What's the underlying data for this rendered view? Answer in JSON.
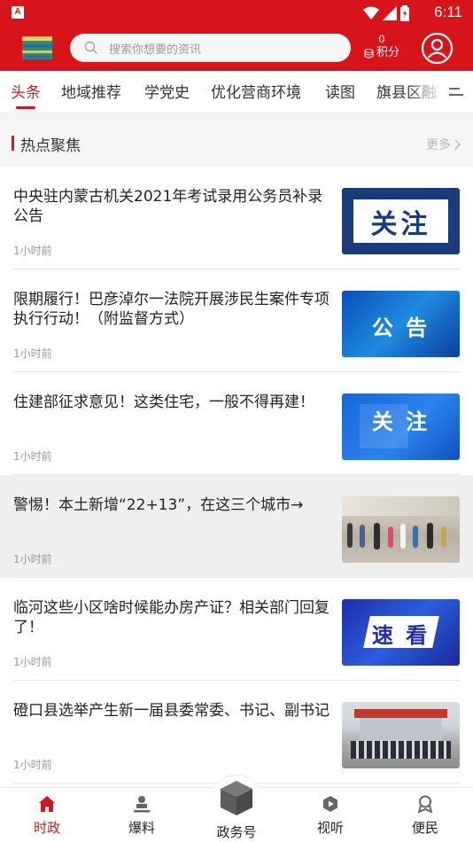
{
  "status_bar": {
    "left_icon": "A",
    "time": "6:11"
  },
  "header": {
    "search_placeholder": "搜索你想要的资讯",
    "points_value": "0",
    "points_label": "积分"
  },
  "tabs": [
    {
      "label": "头条",
      "active": true
    },
    {
      "label": "地域推荐"
    },
    {
      "label": "学党史"
    },
    {
      "label": "优化营商环境"
    },
    {
      "label": "读图"
    },
    {
      "label": "旗县区融"
    }
  ],
  "section": {
    "title": "热点聚焦",
    "more": "更多"
  },
  "news": [
    {
      "title": "中央驻内蒙古机关2021年考试录用公务员补录公告",
      "time": "1小时前",
      "thumb_text": "关注"
    },
    {
      "title": "限期履行！巴彦淖尔一法院开展涉民生案件专项执行行动！（附监督方式）",
      "time": "1小时前",
      "thumb_text": "公 告"
    },
    {
      "title": "住建部征求意见！这类住宅，一般不得再建！",
      "time": "1小时前",
      "thumb_text": "关 注"
    },
    {
      "title": "警惕！本土新增“22+13”，在这三个城市→",
      "time": "1小时前",
      "thumb_text": ""
    },
    {
      "title": "临河这些小区啥时候能办房产证？相关部门回复了！",
      "time": "1小时前",
      "thumb_text": "速 看"
    },
    {
      "title": "磴口县选举产生新一届县委常委、书记、副书记",
      "time": "1小时前",
      "thumb_text": ""
    }
  ],
  "bottom_nav": [
    {
      "label": "时政",
      "icon": "home-icon",
      "active": true
    },
    {
      "label": "爆料",
      "icon": "person-stamp-icon"
    },
    {
      "label": "政务号",
      "icon": "cube-icon"
    },
    {
      "label": "视听",
      "icon": "play-icon"
    },
    {
      "label": "便民",
      "icon": "medal-icon"
    }
  ],
  "colors": {
    "brand": "#d6141a",
    "background": "#ffffff",
    "section_bg": "#f6f6f6"
  }
}
